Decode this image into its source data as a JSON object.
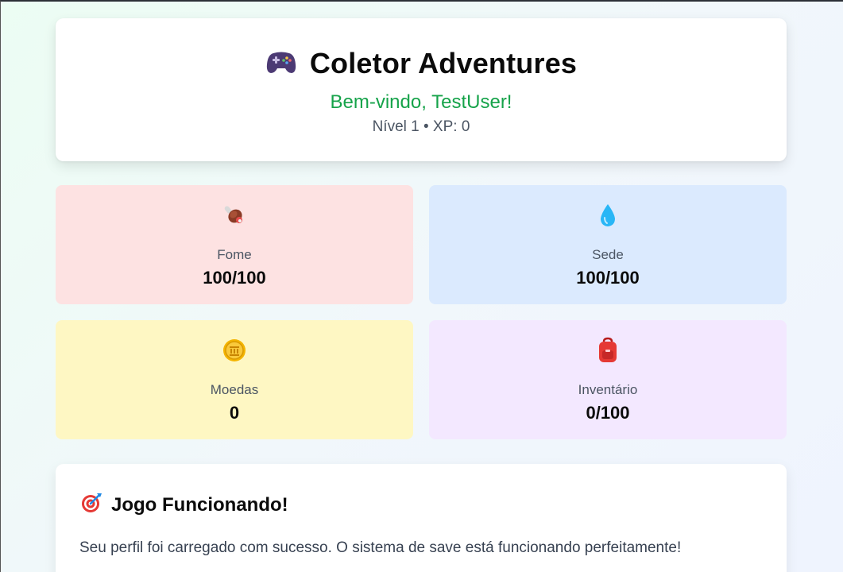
{
  "header": {
    "icon": "gamepad-icon",
    "title": "Coletor Adventures",
    "welcome": "Bem-vindo, TestUser!",
    "level_line": "Nível 1 • XP: 0"
  },
  "stats": [
    {
      "icon": "meat-icon",
      "label": "Fome",
      "value": "100/100",
      "color": "#fde2e2"
    },
    {
      "icon": "water-drop-icon",
      "label": "Sede",
      "value": "100/100",
      "color": "#dbeafe"
    },
    {
      "icon": "coin-icon",
      "label": "Moedas",
      "value": "0",
      "color": "#fef7c3"
    },
    {
      "icon": "backpack-icon",
      "label": "Inventário",
      "value": "0/100",
      "color": "#f3e8ff"
    }
  ],
  "game": {
    "icon": "target-icon",
    "title": "Jogo Funcionando!",
    "text": "Seu perfil foi carregado com sucesso. O sistema de save está funcionando perfeitamente!"
  },
  "colors": {
    "accent_green": "#16a34a",
    "text_dark": "#0b0b0b",
    "text_muted": "#4b5563"
  }
}
